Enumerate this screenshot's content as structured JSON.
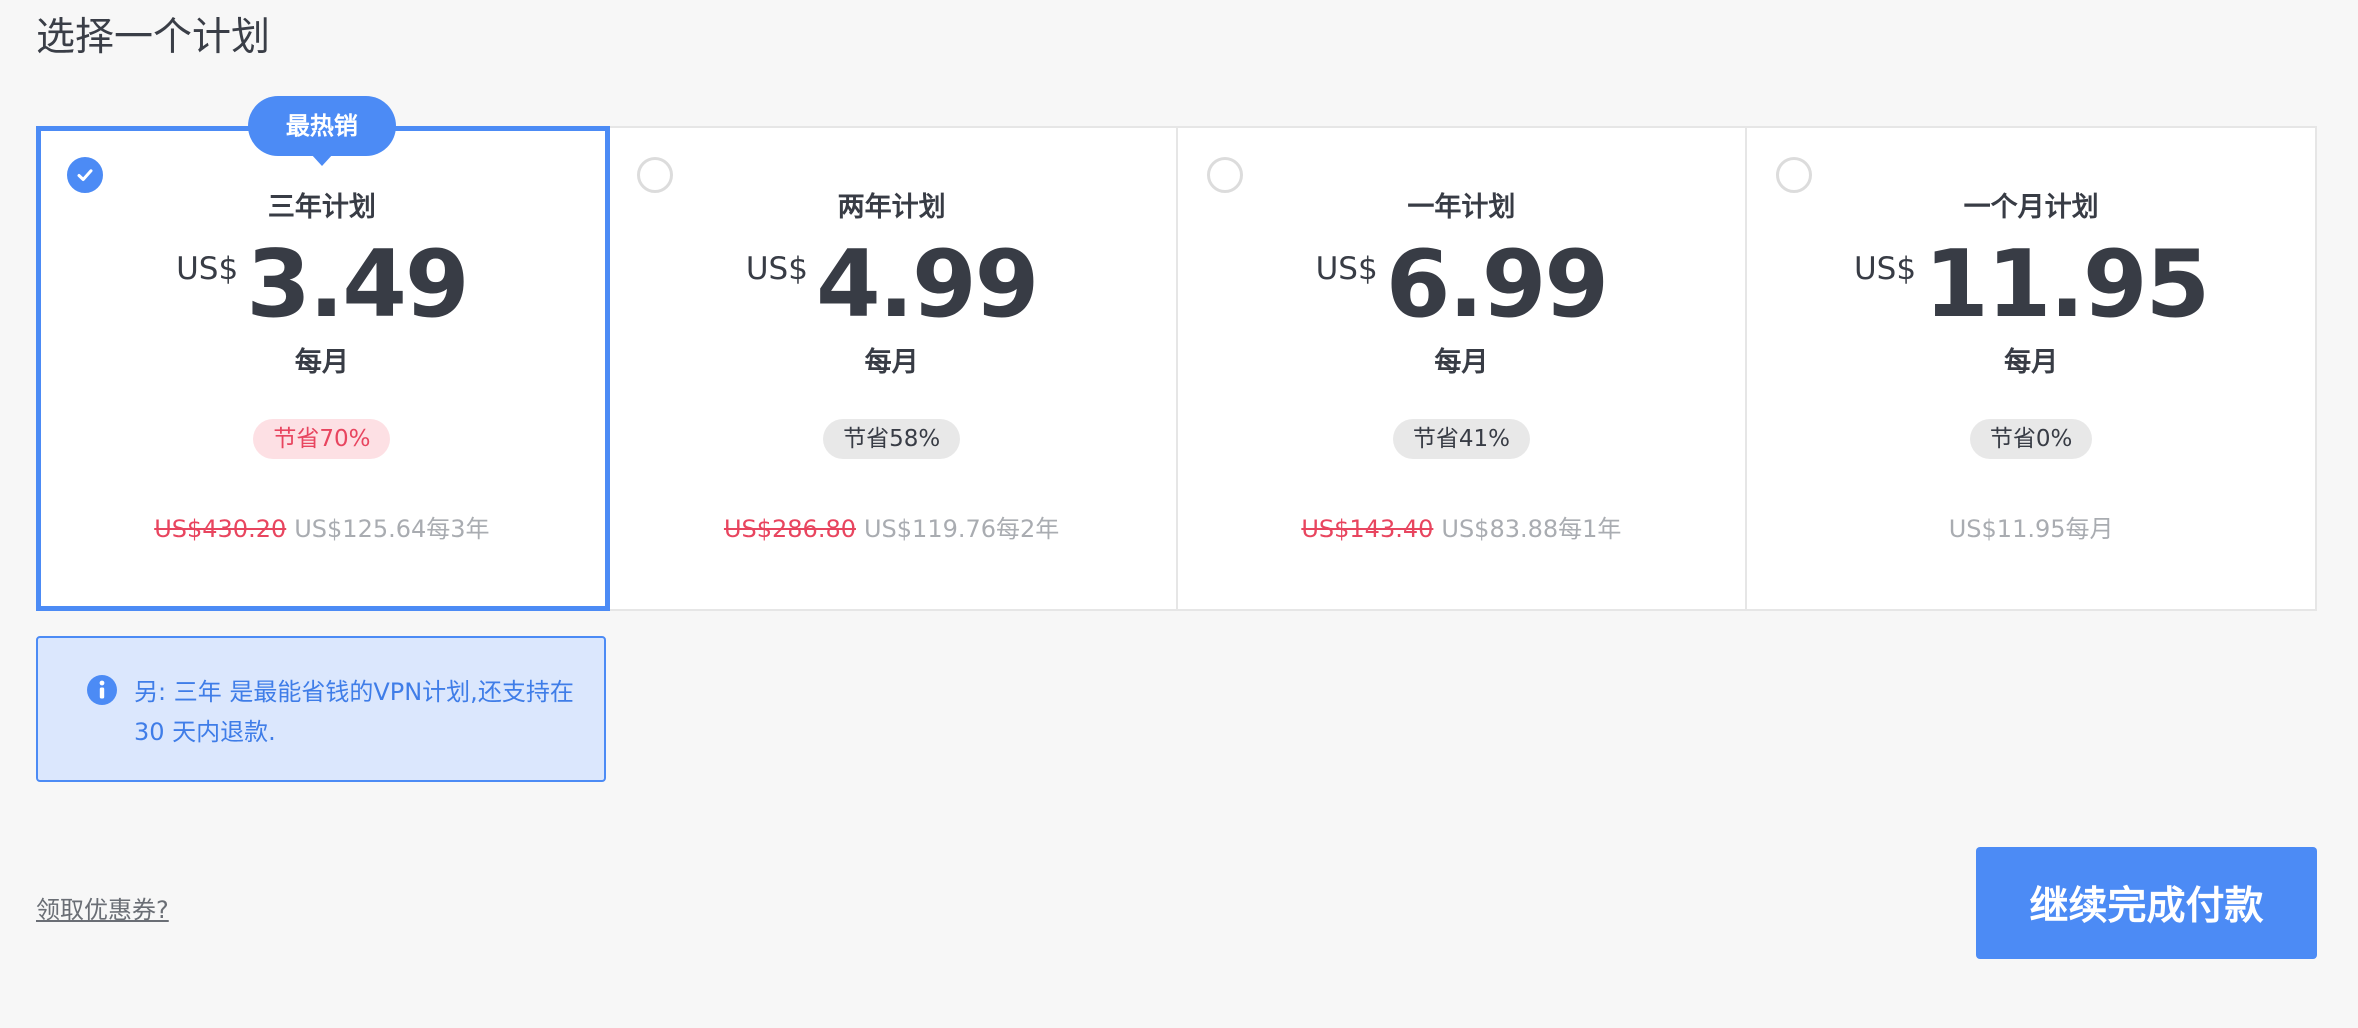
{
  "page": {
    "title": "选择一个计划"
  },
  "plans": [
    {
      "name": "三年计划",
      "currency": "US$",
      "amount": "3.49",
      "period": "每月",
      "save": "节省70%",
      "old_price": "US$430.20",
      "billed": "US$125.64每3年",
      "badge": "最热销",
      "selected": true
    },
    {
      "name": "两年计划",
      "currency": "US$",
      "amount": "4.99",
      "period": "每月",
      "save": "节省58%",
      "old_price": "US$286.80",
      "billed": "US$119.76每2年",
      "selected": false
    },
    {
      "name": "一年计划",
      "currency": "US$",
      "amount": "6.99",
      "period": "每月",
      "save": "节省41%",
      "old_price": "US$143.40",
      "billed": "US$83.88每1年",
      "selected": false
    },
    {
      "name": "一个月计划",
      "currency": "US$",
      "amount": "11.95",
      "period": "每月",
      "save": "节省0%",
      "billed": "US$11.95每月",
      "selected": false
    }
  ],
  "info": {
    "text": "另: 三年 是最能省钱的VPN计划,还支持在 30 天内退款.",
    "icon": "info-icon"
  },
  "coupon": {
    "label": "领取优惠券?"
  },
  "continue": {
    "label": "继续完成付款"
  },
  "colors": {
    "accent": "#4c8bf5",
    "discount_red": "#e8455f",
    "info_bg": "#dbe7fd",
    "page_bg": "#f7f7f7"
  }
}
